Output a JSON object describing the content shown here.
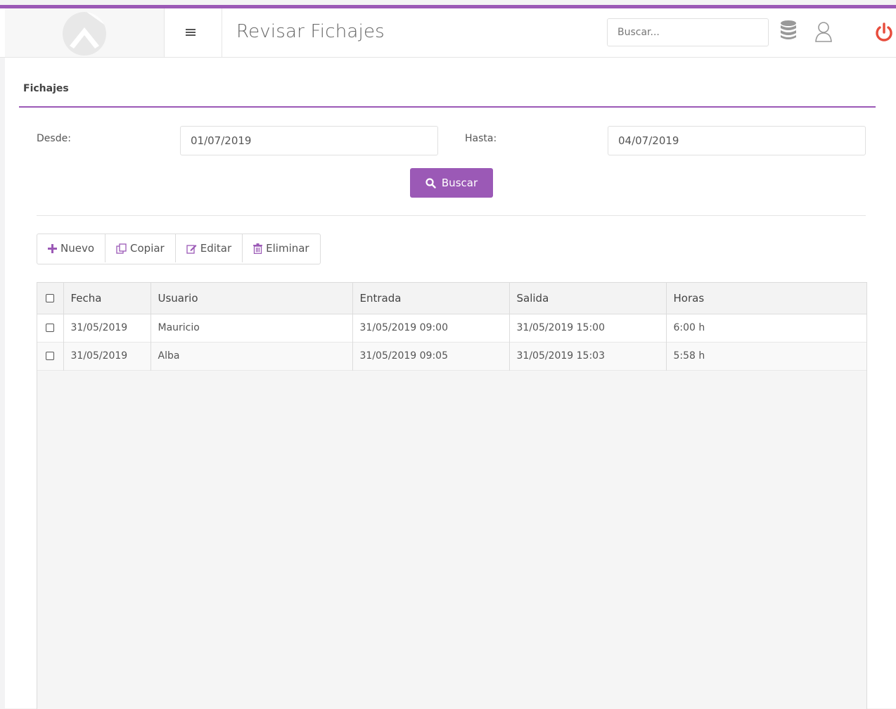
{
  "header": {
    "title": "Revisar Fichajes",
    "search_placeholder": "Buscar...",
    "accent_color": "#9b59b6",
    "icons": [
      "logo-icon",
      "menu-icon",
      "database-icon",
      "user-icon",
      "power-icon"
    ]
  },
  "panel": {
    "title": "Fichajes"
  },
  "filters": {
    "desde_label": "Desde:",
    "desde_value": "01/07/2019",
    "hasta_label": "Hasta:",
    "hasta_value": "04/07/2019",
    "search_button": "Buscar"
  },
  "toolbar": {
    "nuevo": "Nuevo",
    "copiar": "Copiar",
    "editar": "Editar",
    "eliminar": "Eliminar"
  },
  "table": {
    "columns": [
      "Fecha",
      "Usuario",
      "Entrada",
      "Salida",
      "Horas"
    ],
    "rows": [
      {
        "fecha": "31/05/2019",
        "usuario": "Mauricio",
        "entrada": "31/05/2019 09:00",
        "salida": "31/05/2019 15:00",
        "horas": "6:00 h"
      },
      {
        "fecha": "31/05/2019",
        "usuario": "Alba",
        "entrada": "31/05/2019 09:05",
        "salida": "31/05/2019 15:03",
        "horas": "5:58 h"
      }
    ]
  }
}
